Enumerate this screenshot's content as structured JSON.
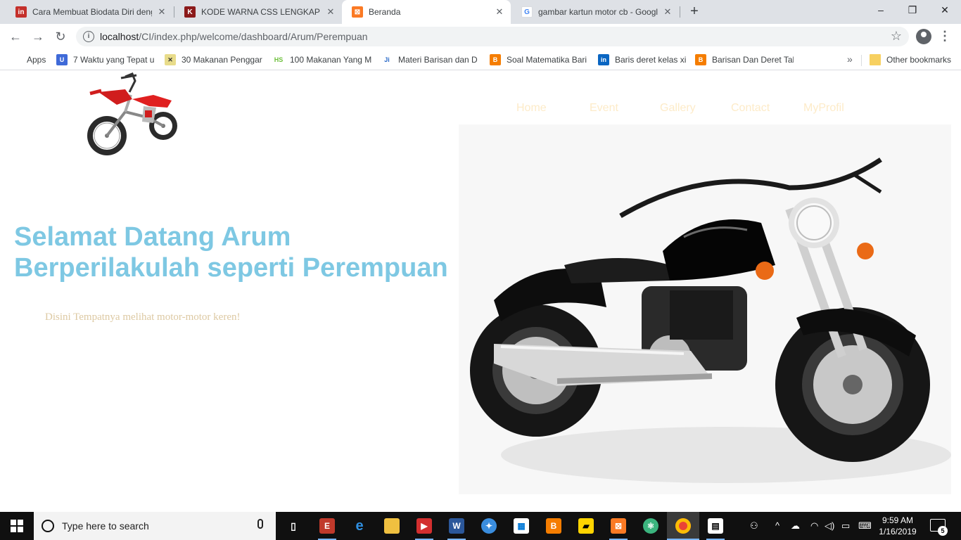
{
  "browser": {
    "tabs": [
      {
        "title": "Cara Membuat Biodata Diri deng",
        "favicon": "linkedin-icon",
        "color": "#c4302b"
      },
      {
        "title": "KODE WARNA CSS LENGKAP - Di",
        "favicon": "site-icon",
        "color": "#8b1a1a"
      },
      {
        "title": "Beranda",
        "favicon": "xampp-icon",
        "color": "#fb7a24"
      },
      {
        "title": "gambar kartun motor cb - Googl",
        "favicon": "google-icon",
        "color": "#4285f4"
      }
    ],
    "active_tab": 2,
    "new_tab_symbol": "+",
    "window_controls": {
      "minimize": "–",
      "restore": "❐",
      "close": "✕"
    },
    "url_host": "localhost",
    "url_path": "/CI/index.php/welcome/dashboard/Arum/Perempuan",
    "bookmarks": [
      {
        "label": "Apps",
        "icon": "apps-grid-icon",
        "color": "#4285f4"
      },
      {
        "label": "7 Waktu yang Tepat u",
        "icon": "bookmark-icon",
        "color": "#3f6ad8"
      },
      {
        "label": "30 Makanan Penggar",
        "icon": "bookmark-icon",
        "color": "#c9b037"
      },
      {
        "label": "100 Makanan Yang M",
        "icon": "bookmark-icon",
        "color": "#6cbf3a"
      },
      {
        "label": "Materi Barisan dan D",
        "icon": "bookmark-icon",
        "color": "#2a6ac8"
      },
      {
        "label": "Soal Matematika Bari",
        "icon": "blogger-icon",
        "color": "#f57d00"
      },
      {
        "label": "Baris deret kelas xi",
        "icon": "linkedin-icon",
        "color": "#0a66c2"
      },
      {
        "label": "Barisan Dan Deret Tal",
        "icon": "blogger-icon",
        "color": "#f57d00"
      }
    ],
    "more_bookmarks_symbol": "»",
    "other_bookmarks": "Other bookmarks"
  },
  "page": {
    "nav": [
      "Home",
      "Event",
      "Gallery",
      "Contact",
      "MyProfil"
    ],
    "hero_line1": "Selamat Datang Arum",
    "hero_line2": "Berperilakulah seperti Perempuan",
    "tagline": "Disini Tempatnya melihat motor-motor keren!",
    "colors": {
      "hero": "#7ec8e3",
      "tagline": "#ddc9a3",
      "nav": "#fdebc8"
    }
  },
  "taskbar": {
    "search_placeholder": "Type here to search",
    "time": "9:59 AM",
    "date": "1/16/2019",
    "notification_count": "5"
  }
}
